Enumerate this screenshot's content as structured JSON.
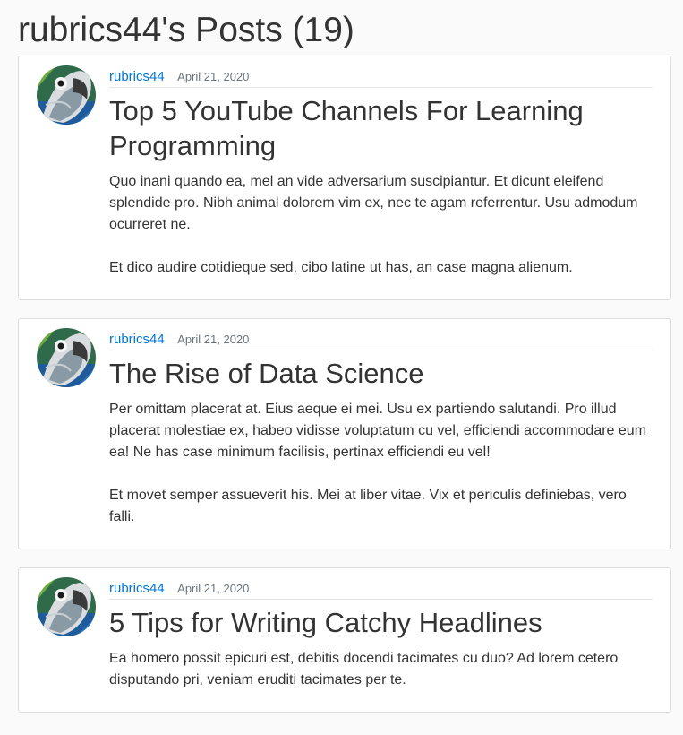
{
  "page": {
    "title": "rubrics44's Posts (19)"
  },
  "posts": [
    {
      "author": "rubrics44",
      "date": "April 21, 2020",
      "title": "Top 5 YouTube Channels For Learning Programming",
      "paragraphs": [
        "Quo inani quando ea, mel an vide adversarium suscipiantur. Et dicunt eleifend splendide pro. Nibh animal dolorem vim ex, nec te agam referrentur. Usu admodum ocurreret ne.",
        "Et dico audire cotidieque sed, cibo latine ut has, an case magna alienum."
      ]
    },
    {
      "author": "rubrics44",
      "date": "April 21, 2020",
      "title": "The Rise of Data Science",
      "paragraphs": [
        "Per omittam placerat at. Eius aeque ei mei. Usu ex partiendo salutandi. Pro illud placerat molestiae ex, habeo vidisse voluptatum cu vel, efficiendi accommodare eum ea! Ne has case minimum facilisis, pertinax efficiendi eu vel!",
        "Et movet semper assueverit his. Mei at liber vitae. Vix et periculis definiebas, vero falli."
      ]
    },
    {
      "author": "rubrics44",
      "date": "April 21, 2020",
      "title": "5 Tips for Writing Catchy Headlines",
      "paragraphs": [
        "Ea homero possit epicuri est, debitis docendi tacimates cu duo? Ad lorem cetero disputando pri, veniam eruditi tacimates per te."
      ]
    }
  ],
  "colors": {
    "author_link": "#0275d8",
    "text": "#333333",
    "muted": "#6c757d"
  },
  "icons": {
    "avatar": "parrot-avatar-icon"
  }
}
